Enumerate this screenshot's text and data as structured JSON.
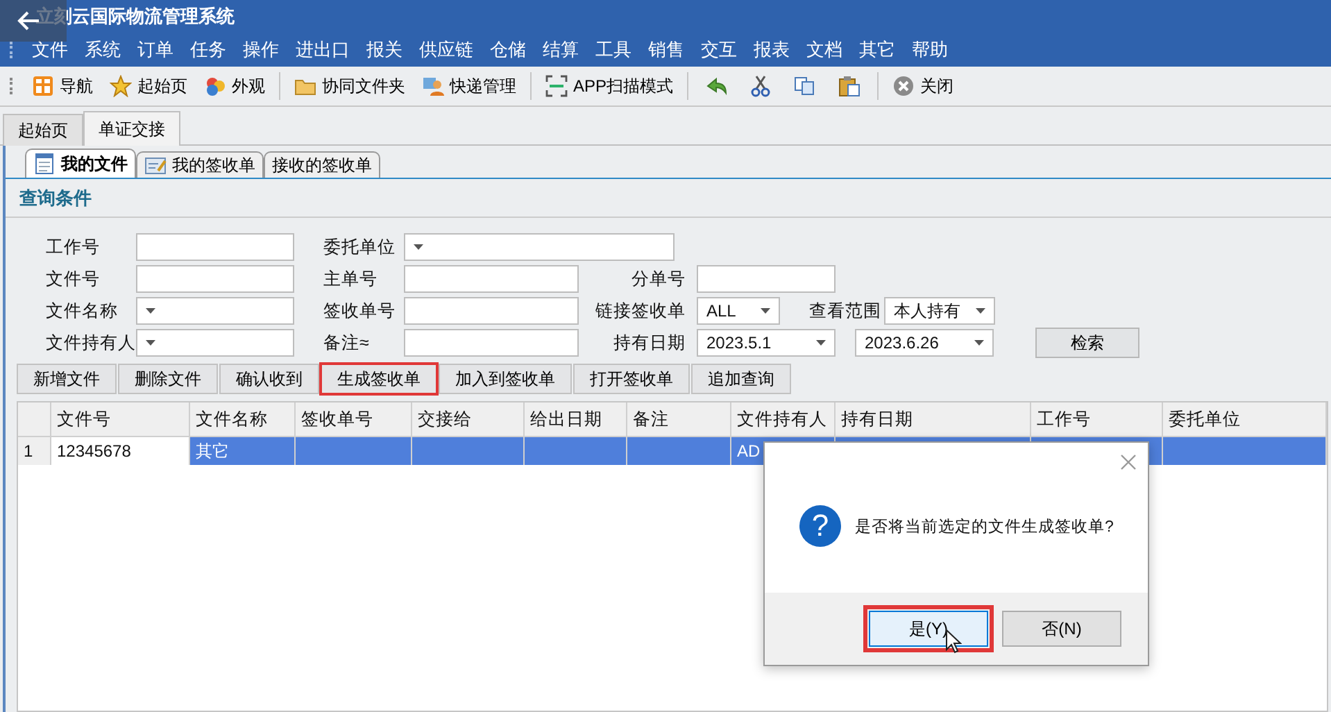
{
  "window": {
    "title": "立刻云国际物流管理系统"
  },
  "menu": [
    "文件",
    "系统",
    "订单",
    "任务",
    "操作",
    "进出口",
    "报关",
    "供应链",
    "仓储",
    "结算",
    "工具",
    "销售",
    "交互",
    "报表",
    "文档",
    "其它",
    "帮助"
  ],
  "toolbar": [
    {
      "kind": "button",
      "label": "导航"
    },
    {
      "kind": "button",
      "label": "起始页"
    },
    {
      "kind": "button",
      "label": "外观"
    },
    {
      "kind": "separator"
    },
    {
      "kind": "button",
      "label": "协同文件夹"
    },
    {
      "kind": "button",
      "label": "快递管理"
    },
    {
      "kind": "separator"
    },
    {
      "kind": "button",
      "label": "APP扫描模式"
    },
    {
      "kind": "separator"
    },
    {
      "kind": "icon"
    },
    {
      "kind": "icon"
    },
    {
      "kind": "icon"
    },
    {
      "kind": "icon"
    },
    {
      "kind": "separator"
    },
    {
      "kind": "button",
      "label": "关闭"
    }
  ],
  "tabs": [
    {
      "label": "起始页",
      "selected": false
    },
    {
      "label": "单证交接",
      "selected": true
    }
  ],
  "subtabs": [
    {
      "label": "我的文件",
      "selected": true
    },
    {
      "label": "我的签收单",
      "selected": false
    },
    {
      "label": "接收的签收单",
      "selected": false
    }
  ],
  "query": {
    "title": "查询条件",
    "rows": [
      [
        {
          "label": "工作号",
          "kind": "text"
        },
        {
          "label": "委托单位",
          "kind": "wide-combo"
        }
      ],
      [
        {
          "label": "文件号",
          "kind": "text"
        },
        {
          "label": "主单号",
          "kind": "text"
        },
        {
          "label": "分单号",
          "kind": "text"
        }
      ],
      [
        {
          "label": "文件名称",
          "kind": "combo"
        },
        {
          "label": "签收单号",
          "kind": "text"
        },
        {
          "label": "链接签收单",
          "kind": "small-combo",
          "value": "ALL"
        },
        {
          "label": "查看范围",
          "kind": "small-combo",
          "value": "本人持有"
        }
      ],
      [
        {
          "label": "文件持有人",
          "kind": "combo"
        },
        {
          "label": "备注≈",
          "kind": "text"
        },
        {
          "label": "持有日期",
          "kind": "combo",
          "value": "2023.5.1"
        },
        {
          "kind": "combo",
          "value": "2023.6.26"
        },
        {
          "kind": "button",
          "label": "检索"
        }
      ]
    ]
  },
  "actions": [
    {
      "label": "新增文件",
      "highlighted": false
    },
    {
      "label": "删除文件",
      "highlighted": false
    },
    {
      "label": "确认收到",
      "highlighted": false
    },
    {
      "label": "生成签收单",
      "highlighted": true
    },
    {
      "label": "加入到签收单",
      "highlighted": false
    },
    {
      "label": "打开签收单",
      "highlighted": false
    },
    {
      "label": "追加查询",
      "highlighted": false
    }
  ],
  "table": {
    "columns": [
      "文件号",
      "文件名称",
      "签收单号",
      "交接给",
      "给出日期",
      "备注",
      "文件持有人",
      "持有日期",
      "工作号",
      "委托单位"
    ],
    "rows": [
      {
        "number": "1",
        "selected": true,
        "cells": [
          "12345678",
          "其它",
          null,
          null,
          null,
          null,
          "AD"
        ]
      }
    ]
  },
  "dialog": {
    "icon": "?",
    "message": "是否将当前选定的文件生成签收单?",
    "buttons": [
      {
        "label": "是(Y)",
        "highlighted": true
      },
      {
        "label": "否(N)",
        "highlighted": false
      }
    ]
  }
}
